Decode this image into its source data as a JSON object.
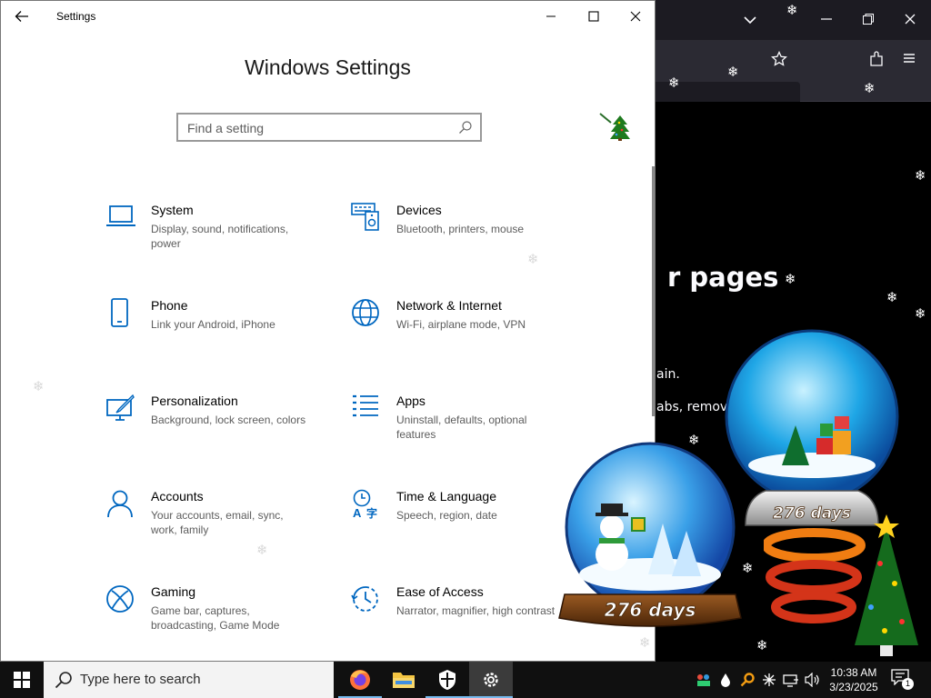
{
  "browser": {
    "heading_fragment": "r pages",
    "line1": "ain.",
    "line2": "abs, remove"
  },
  "settings": {
    "window_title": "Settings",
    "page_title": "Windows Settings",
    "search_placeholder": "Find a setting",
    "tiles": [
      {
        "title": "System",
        "desc": "Display, sound, notifications, power",
        "icon": "laptop-icon"
      },
      {
        "title": "Devices",
        "desc": "Bluetooth, printers, mouse",
        "icon": "keyboard-speaker-icon"
      },
      {
        "title": "Phone",
        "desc": "Link your Android, iPhone",
        "icon": "phone-icon"
      },
      {
        "title": "Network & Internet",
        "desc": "Wi-Fi, airplane mode, VPN",
        "icon": "globe-icon"
      },
      {
        "title": "Personalization",
        "desc": "Background, lock screen, colors",
        "icon": "paintbrush-icon"
      },
      {
        "title": "Apps",
        "desc": "Uninstall, defaults, optional features",
        "icon": "app-list-icon"
      },
      {
        "title": "Accounts",
        "desc": "Your accounts, email, sync, work, family",
        "icon": "person-icon"
      },
      {
        "title": "Time & Language",
        "desc": "Speech, region, date",
        "icon": "time-language-icon"
      },
      {
        "title": "Gaming",
        "desc": "Game bar, captures, broadcasting, Game Mode",
        "icon": "xbox-icon"
      },
      {
        "title": "Ease of Access",
        "desc": "Narrator, magnifier, high contrast",
        "icon": "ease-of-access-icon"
      }
    ]
  },
  "decorations": {
    "globe_small_label": "276 days",
    "globe_large_label": "276 days"
  },
  "taskbar": {
    "search_placeholder": "Type here to search",
    "time": "10:38 AM",
    "date": "3/23/2025",
    "notification_count": "1"
  },
  "colors": {
    "accent": "#0067c0",
    "taskbar": "#101010",
    "browser_bg": "#1c1b22"
  }
}
